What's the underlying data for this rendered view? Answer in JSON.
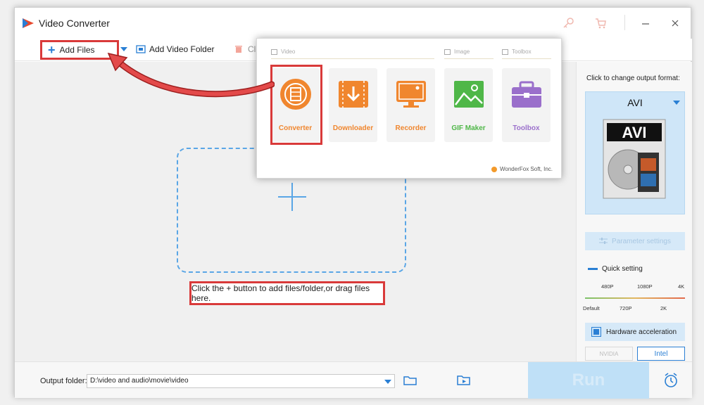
{
  "window": {
    "title": "Video Converter"
  },
  "toolbar": {
    "add_files": "Add Files",
    "add_folder": "Add Video Folder",
    "clear": "Cl"
  },
  "main": {
    "hint": "Click the + button to add files/folder,or drag files here."
  },
  "popup": {
    "categories": {
      "video": "Video",
      "image": "Image",
      "toolbox": "Toolbox"
    },
    "tools": [
      {
        "label": "Converter",
        "color": "#f0862e"
      },
      {
        "label": "Downloader",
        "color": "#f0862e"
      },
      {
        "label": "Recorder",
        "color": "#f0862e"
      },
      {
        "label": "GIF Maker",
        "color": "#4fb748"
      },
      {
        "label": "Toolbox",
        "color": "#9a6fcb"
      }
    ],
    "brand": "WonderFox Soft, Inc."
  },
  "right_panel": {
    "title": "Click to change output format:",
    "format": "AVI",
    "parameter_settings": "Parameter settings",
    "quick_setting": "Quick setting",
    "ticks_top": [
      "480P",
      "1080P",
      "4K"
    ],
    "ticks_bottom": [
      "Default",
      "720P",
      "2K"
    ],
    "hardware_acceleration": "Hardware acceleration",
    "nvidia": "NVIDIA",
    "intel": "Intel"
  },
  "bottom": {
    "output_label": "Output folder:",
    "output_path": "D:\\video and audio\\movie\\video",
    "run": "Run"
  },
  "colors": {
    "accent": "#2a7fd4",
    "highlight": "#d93a3a",
    "run_bg": "#bfe0f7"
  }
}
